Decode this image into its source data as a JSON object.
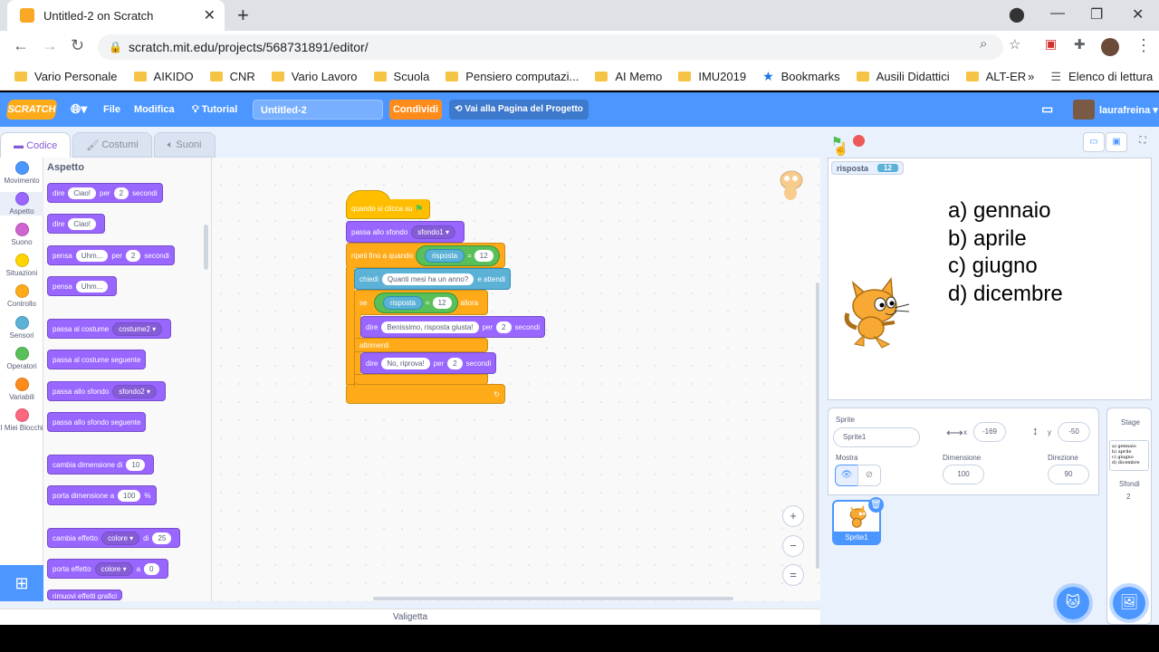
{
  "browser": {
    "tab_title": "Untitled-2 on Scratch",
    "new_tab": "+",
    "url": "scratch.mit.edu/projects/568731891/editor/",
    "bookmarks": [
      "Vario Personale",
      "AIKIDO",
      "CNR",
      "Vario Lavoro",
      "Scuola",
      "Pensiero computazi...",
      "AI Memo",
      "IMU2019",
      "Bookmarks",
      "Ausili Didattici",
      "ALT-ER"
    ],
    "reading_list": "Elenco di lettura",
    "more": "»"
  },
  "menu": {
    "logo": "SCRATCH",
    "file": "File",
    "edit": "Modifica",
    "tutorial": "Tutorial",
    "project_title": "Untitled-2",
    "share": "Condividi",
    "project_page": "Vai alla Pagina del Progetto",
    "user": "laurafreina"
  },
  "tabs": {
    "code": "Codice",
    "costumes": "Costumi",
    "sounds": "Suoni"
  },
  "categories": [
    {
      "label": "Movimento",
      "color": "#4c97ff"
    },
    {
      "label": "Aspetto",
      "color": "#9966ff"
    },
    {
      "label": "Suono",
      "color": "#cf63cf"
    },
    {
      "label": "Situazioni",
      "color": "#ffd500"
    },
    {
      "label": "Controllo",
      "color": "#ffab19"
    },
    {
      "label": "Sensori",
      "color": "#5cb1d6"
    },
    {
      "label": "Operatori",
      "color": "#59c059"
    },
    {
      "label": "Variabili",
      "color": "#ff8c1a"
    },
    {
      "label": "I Miei Blocchi",
      "color": "#ff6680"
    }
  ],
  "palette": {
    "title": "Aspetto",
    "b1": {
      "a": "dire",
      "b": "Ciao!",
      "c": "per",
      "d": "2",
      "e": "secondi"
    },
    "b2": {
      "a": "dire",
      "b": "Ciao!"
    },
    "b3": {
      "a": "pensa",
      "b": "Uhm...",
      "c": "per",
      "d": "2",
      "e": "secondi"
    },
    "b4": {
      "a": "pensa",
      "b": "Uhm..."
    },
    "b5": {
      "a": "passa al costume",
      "b": "costume2 ▾"
    },
    "b6": {
      "a": "passa al costume seguente"
    },
    "b7": {
      "a": "passa allo sfondo",
      "b": "sfondo2 ▾"
    },
    "b8": {
      "a": "passa allo sfondo seguente"
    },
    "b9": {
      "a": "cambia dimensione di",
      "b": "10"
    },
    "b10": {
      "a": "porta dimensione a",
      "b": "100",
      "c": "%"
    },
    "b11": {
      "a": "cambia effetto",
      "b": "colore ▾",
      "c": "di",
      "d": "25"
    },
    "b12": {
      "a": "porta effetto",
      "b": "colore ▾",
      "c": "a",
      "d": "0"
    },
    "b13": {
      "a": "rimuovi effetti grafici"
    }
  },
  "script": {
    "hat": "quando si clicca su",
    "backdrop": {
      "a": "passa allo sfondo",
      "b": "sfondo1 ▾"
    },
    "repeat": {
      "a": "ripeti fino a quando",
      "var": "risposta",
      "op": "=",
      "val": "12"
    },
    "ask": {
      "a": "chiedi",
      "b": "Quanti mesi ha un anno?",
      "c": "e attendi"
    },
    "if": {
      "a": "se",
      "var": "risposta",
      "op": "=",
      "val": "12",
      "b": "allora"
    },
    "say1": {
      "a": "dire",
      "b": "Benissimo, risposta giusta!",
      "c": "per",
      "d": "2",
      "e": "secondi"
    },
    "else": "altrimenti",
    "say2": {
      "a": "dire",
      "b": "No, riprova!",
      "c": "per",
      "d": "2",
      "e": "secondi"
    }
  },
  "backpack": "Valigetta",
  "stage": {
    "monitor_label": "risposta",
    "monitor_value": "12",
    "answers": [
      "a) gennaio",
      "b) aprile",
      "c) giugno",
      "d) dicembre"
    ]
  },
  "sprite": {
    "label_sprite": "Sprite",
    "name": "Sprite1",
    "x_label": "x",
    "x": "-169",
    "y_label": "y",
    "y": "-50",
    "show_label": "Mostra",
    "size_label": "Dimensione",
    "size": "100",
    "direction_label": "Direzione",
    "direction": "90",
    "thumb_name": "Sprite1"
  },
  "stage_panel": {
    "title": "Stage",
    "backdrops_label": "Sfondi",
    "backdrops_count": "2"
  }
}
